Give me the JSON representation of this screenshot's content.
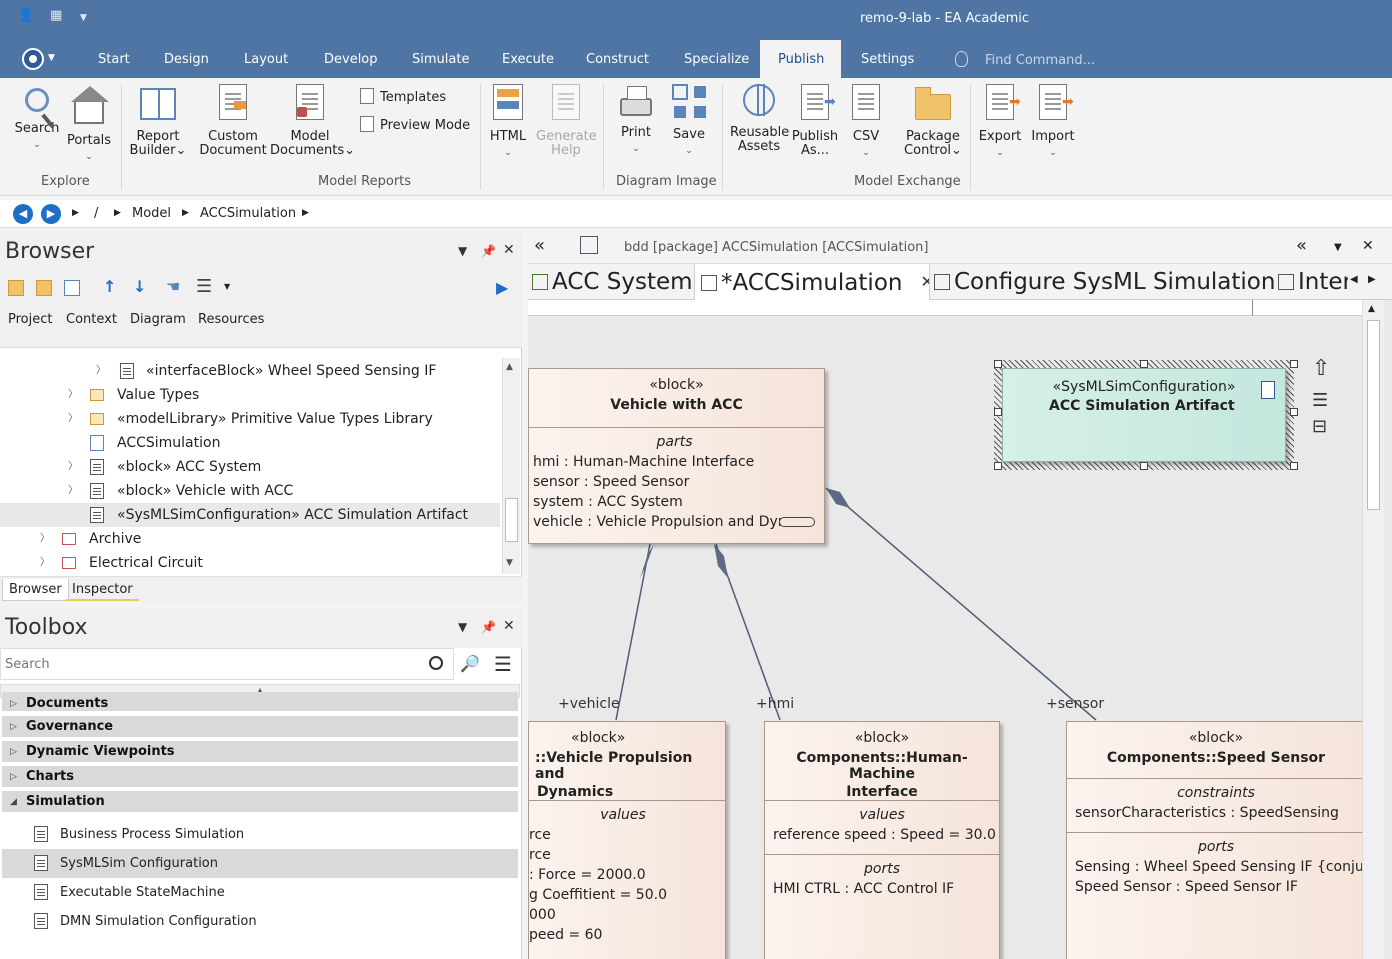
{
  "window": {
    "title": "remo-9-lab - EA Academic"
  },
  "ribbon_tabs": [
    "Start",
    "Design",
    "Layout",
    "Develop",
    "Simulate",
    "Execute",
    "Construct",
    "Specialize",
    "Publish",
    "Settings"
  ],
  "active_ribbon_tab": "Publish",
  "find_command": "Find Command...",
  "ribbon": {
    "search": "Search",
    "portals": "Portals",
    "explore": "Explore",
    "report_builder_1": "Report",
    "report_builder_2": "Builder",
    "custom_doc_1": "Custom",
    "custom_doc_2": "Document",
    "model_docs_1": "Model",
    "model_docs_2": "Documents",
    "templates": "Templates",
    "preview_mode": "Preview Mode",
    "model_reports": "Model Reports",
    "html": "HTML",
    "generate_help_1": "Generate",
    "generate_help_2": "Help",
    "print": "Print",
    "save": "Save",
    "diagram_image": "Diagram Image",
    "reusable_1": "Reusable",
    "reusable_2": "Assets",
    "publish_as_1": "Publish",
    "publish_as_2": "As...",
    "csv": "CSV",
    "package_control_1": "Package",
    "package_control_2": "Control",
    "export": "Export",
    "import": "Import",
    "model_exchange": "Model Exchange"
  },
  "breadcrumb": {
    "root": "/",
    "model": "Model",
    "package": "ACCSimulation"
  },
  "browser": {
    "title": "Browser",
    "tabs": [
      "Project",
      "Context",
      "Diagram",
      "Resources"
    ],
    "tree": [
      {
        "label": "«interfaceBlock» Wheel Speed Sensing IF",
        "icon": "block-icon"
      },
      {
        "label": "Value Types",
        "icon": "folder-icon"
      },
      {
        "label": "«modelLibrary» Primitive Value Types Library",
        "icon": "folder-icon"
      },
      {
        "label": "ACCSimulation",
        "icon": "diagram-icon"
      },
      {
        "label": "«block» ACC System",
        "icon": "block-icon"
      },
      {
        "label": "«block» Vehicle with ACC",
        "icon": "block-icon"
      },
      {
        "label": "«SysMLSimConfiguration» ACC Simulation Artifact",
        "icon": "artifact-icon"
      },
      {
        "label": "Archive",
        "icon": "package-icon"
      },
      {
        "label": "Electrical Circuit",
        "icon": "package-icon"
      }
    ],
    "bottom_tabs": [
      "Browser",
      "Inspector"
    ]
  },
  "toolbox": {
    "title": "Toolbox",
    "search_placeholder": "Search",
    "categories": [
      "Documents",
      "Governance",
      "Dynamic Viewpoints",
      "Charts",
      "Simulation"
    ],
    "items": [
      "Business Process Simulation",
      "SysMLSim Configuration",
      "Executable StateMachine",
      "DMN Simulation Configuration"
    ],
    "selected_item": "SysMLSim Configuration"
  },
  "diagram": {
    "header": "bdd [package] ACCSimulation [ACCSimulation]",
    "tabs": [
      "ACC System",
      "*ACCSimulation",
      "Configure SysML Simulation",
      "Inter"
    ],
    "active_tab": "*ACCSimulation",
    "vehicle_with_acc": {
      "stereotype": "«block»",
      "name": "Vehicle with ACC",
      "section": "parts",
      "parts": [
        "hmi : Human-Machine Interface",
        "sensor : Speed Sensor",
        "system : ACC System",
        "vehicle : Vehicle Propulsion and Dynamics"
      ]
    },
    "artifact": {
      "stereotype": "«SysMLSimConfiguration»",
      "name": "ACC Simulation Artifact"
    },
    "propulsion": {
      "stereotype": "«block»",
      "name_1": "::Vehicle Propulsion and",
      "name_2": "Dynamics",
      "section": "values",
      "values": [
        "rce",
        "rce",
        ": Force = 2000.0",
        "g Coeffitient = 50.0",
        "000",
        "peed = 60"
      ]
    },
    "hmi_block": {
      "stereotype": "«block»",
      "name_1": "Components::Human-Machine",
      "name_2": "Interface",
      "values_label": "values",
      "values": [
        "reference speed : Speed = 30.0"
      ],
      "ports_label": "ports",
      "ports": [
        "HMI CTRL : ACC Control IF"
      ]
    },
    "sensor_block": {
      "stereotype": "«block»",
      "name": "Components::Speed Sensor",
      "constraints_label": "constraints",
      "constraints": [
        "sensorCharacteristics : SpeedSensing"
      ],
      "ports_label": "ports",
      "ports": [
        "Sensing : Wheel Speed Sensing IF {conjugated}",
        "Speed Sensor : Speed Sensor IF"
      ]
    },
    "roles": [
      "+vehicle",
      "+hmi",
      "+sensor"
    ]
  }
}
